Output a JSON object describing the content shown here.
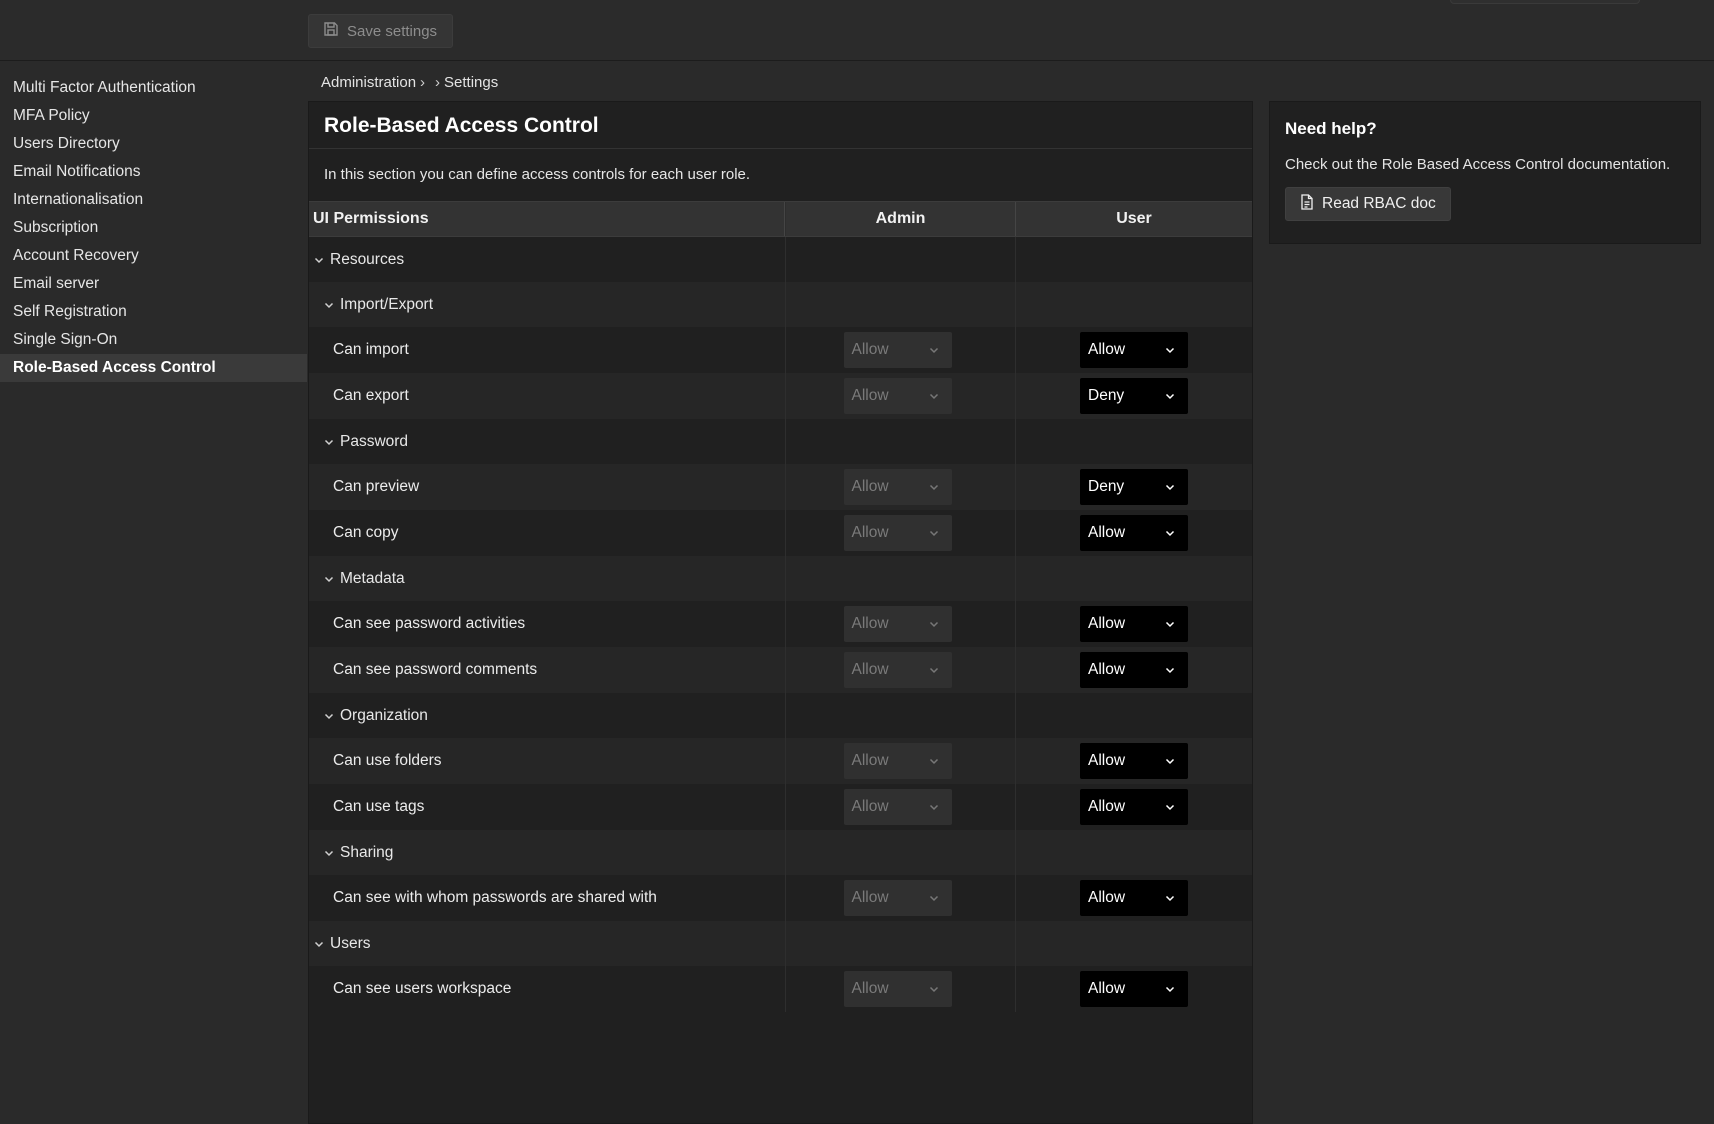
{
  "toolbar": {
    "save_label": "Save settings"
  },
  "sidebar": {
    "items": [
      {
        "label": "Multi Factor Authentication"
      },
      {
        "label": "MFA Policy"
      },
      {
        "label": "Users Directory"
      },
      {
        "label": "Email Notifications"
      },
      {
        "label": "Internationalisation"
      },
      {
        "label": "Subscription"
      },
      {
        "label": "Account Recovery"
      },
      {
        "label": "Email server"
      },
      {
        "label": "Self Registration"
      },
      {
        "label": "Single Sign-On"
      },
      {
        "label": "Role-Based Access Control",
        "active": true
      }
    ]
  },
  "breadcrumb": {
    "first": "Administration",
    "sep1": "›",
    "sep2": "›",
    "last": "Settings"
  },
  "main": {
    "title": "Role-Based Access Control",
    "intro": "In this section you can define access controls for each user role.",
    "headers": {
      "permissions": "UI Permissions",
      "admin": "Admin",
      "user": "User"
    },
    "rows": [
      {
        "kind": "cat",
        "label": "Resources"
      },
      {
        "kind": "sub",
        "label": "Import/Export"
      },
      {
        "kind": "perm",
        "label": "Can import",
        "admin": "Allow",
        "user": "Allow"
      },
      {
        "kind": "perm",
        "label": "Can export",
        "admin": "Allow",
        "user": "Deny"
      },
      {
        "kind": "sub",
        "label": "Password"
      },
      {
        "kind": "perm",
        "label": "Can preview",
        "admin": "Allow",
        "user": "Deny"
      },
      {
        "kind": "perm",
        "label": "Can copy",
        "admin": "Allow",
        "user": "Allow"
      },
      {
        "kind": "sub",
        "label": "Metadata"
      },
      {
        "kind": "perm",
        "label": "Can see password activities",
        "admin": "Allow",
        "user": "Allow"
      },
      {
        "kind": "perm",
        "label": "Can see password comments",
        "admin": "Allow",
        "user": "Allow"
      },
      {
        "kind": "sub",
        "label": "Organization"
      },
      {
        "kind": "perm",
        "label": "Can use folders",
        "admin": "Allow",
        "user": "Allow"
      },
      {
        "kind": "perm",
        "label": "Can use tags",
        "admin": "Allow",
        "user": "Allow"
      },
      {
        "kind": "sub",
        "label": "Sharing"
      },
      {
        "kind": "perm",
        "label": "Can see with whom passwords are shared with",
        "admin": "Allow",
        "user": "Allow"
      },
      {
        "kind": "cat",
        "label": "Users"
      },
      {
        "kind": "perm",
        "label": "Can see users workspace",
        "admin": "Allow",
        "user": "Allow"
      }
    ]
  },
  "help": {
    "title": "Need help?",
    "text": "Check out the Role Based Access Control documentation.",
    "button_label": "Read RBAC doc"
  },
  "icons": {
    "save": "floppy-disk-icon",
    "chevron": "chevron-down-icon",
    "document": "document-icon"
  },
  "colors": {
    "background": "#2a2a2a",
    "panel": "#202020",
    "header_row": "#333333",
    "active_select": "#000000",
    "disabled_select": "#303030",
    "sidebar_active": "#3a3a3a"
  }
}
